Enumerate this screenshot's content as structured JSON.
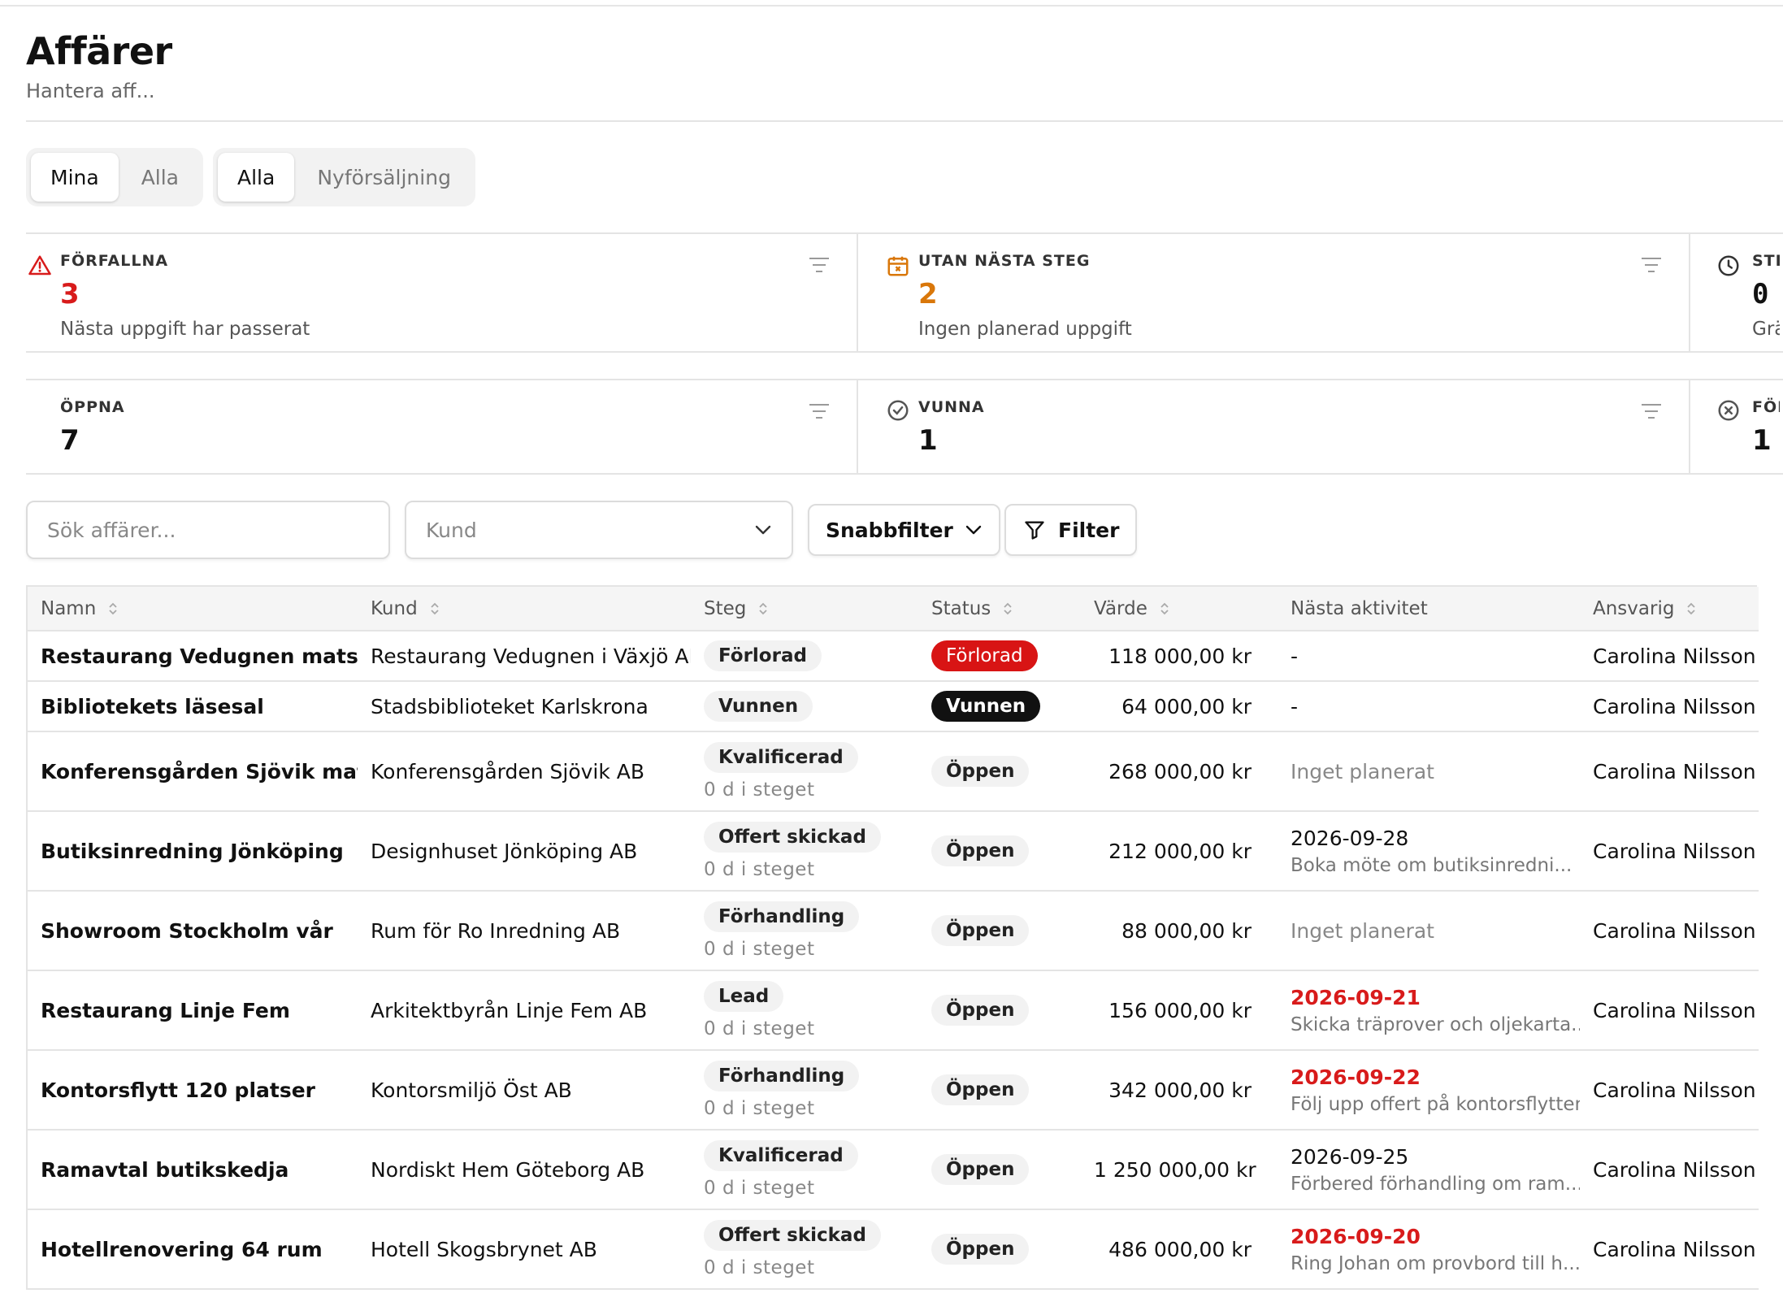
{
  "page": {
    "title": "Affärer",
    "subtitle": "Hantera aff..."
  },
  "scope_toggle": {
    "options": [
      "Mina",
      "Alla"
    ],
    "active": "Mina"
  },
  "type_toggle": {
    "options": [
      "Alla",
      "Nyförsäljning"
    ],
    "active": "Alla"
  },
  "kpis_top": [
    {
      "label": "FÖRFALLNA",
      "value": "3",
      "description": "Nästa uppgift har passerat",
      "icon": "warning-triangle-icon",
      "color": "#d81b1b"
    },
    {
      "label": "UTAN NÄSTA STEG",
      "value": "2",
      "description": "Ingen planerad uppgift",
      "icon": "calendar-x-icon",
      "color": "#d9770a"
    },
    {
      "label": "STILLA",
      "value": "0",
      "description": "Gränse",
      "icon": "clock-icon",
      "color": "#111111"
    }
  ],
  "kpis_bottom": [
    {
      "label": "ÖPPNA",
      "value": "7",
      "icon": ""
    },
    {
      "label": "VUNNA",
      "value": "1",
      "icon": "check-circle-icon"
    },
    {
      "label": "FÖRLOR",
      "value": "1",
      "icon": "x-circle-icon"
    }
  ],
  "toolbar": {
    "search_placeholder": "Sök affärer...",
    "customer_placeholder": "Kund",
    "quick_filter_label": "Snabbfilter",
    "filter_label": "Filter"
  },
  "table": {
    "columns": [
      "Namn",
      "Kund",
      "Steg",
      "Status",
      "Värde",
      "Nästa aktivitet",
      "Ansvarig"
    ],
    "rows": [
      {
        "name": "Restaurang Vedugnen matsal",
        "customer": "Restaurang Vedugnen i Växjö AB",
        "stage": "Förlorad",
        "days": "",
        "status": "Förlorad",
        "status_type": "lost",
        "value": "118 000,00 kr",
        "next_date": "-",
        "next_desc": "",
        "overdue": false,
        "owner": "Carolina Nilsson"
      },
      {
        "name": "Bibliotekets läsesal",
        "customer": "Stadsbiblioteket Karlskrona",
        "stage": "Vunnen",
        "days": "",
        "status": "Vunnen",
        "status_type": "won",
        "value": "64 000,00 kr",
        "next_date": "-",
        "next_desc": "",
        "overdue": false,
        "owner": "Carolina Nilsson"
      },
      {
        "name": "Konferensgården Sjövik matsal",
        "customer": "Konferensgården Sjövik AB",
        "stage": "Kvalificerad",
        "days": "0 d i steget",
        "status": "Öppen",
        "status_type": "open",
        "value": "268 000,00 kr",
        "next_date": "Inget planerat",
        "next_desc": "",
        "overdue": false,
        "muted": true,
        "owner": "Carolina Nilsson"
      },
      {
        "name": "Butiksinredning Jönköping",
        "customer": "Designhuset Jönköping AB",
        "stage": "Offert skickad",
        "days": "0 d i steget",
        "status": "Öppen",
        "status_type": "open",
        "value": "212 000,00 kr",
        "next_date": "2026-09-28",
        "next_desc": "Boka möte om butiksinredni...",
        "overdue": false,
        "owner": "Carolina Nilsson"
      },
      {
        "name": "Showroom Stockholm vår",
        "customer": "Rum för Ro Inredning AB",
        "stage": "Förhandling",
        "days": "0 d i steget",
        "status": "Öppen",
        "status_type": "open",
        "value": "88 000,00 kr",
        "next_date": "Inget planerat",
        "next_desc": "",
        "overdue": false,
        "muted": true,
        "owner": "Carolina Nilsson"
      },
      {
        "name": "Restaurang Linje Fem",
        "customer": "Arkitektbyrån Linje Fem AB",
        "stage": "Lead",
        "days": "0 d i steget",
        "status": "Öppen",
        "status_type": "open",
        "value": "156 000,00 kr",
        "next_date": "2026-09-21",
        "next_desc": "Skicka träprover och oljekarta...",
        "overdue": true,
        "owner": "Carolina Nilsson"
      },
      {
        "name": "Kontorsflytt 120 platser",
        "customer": "Kontorsmiljö Öst AB",
        "stage": "Förhandling",
        "days": "0 d i steget",
        "status": "Öppen",
        "status_type": "open",
        "value": "342 000,00 kr",
        "next_date": "2026-09-22",
        "next_desc": "Följ upp offert på kontorsflytten",
        "overdue": true,
        "owner": "Carolina Nilsson"
      },
      {
        "name": "Ramavtal butikskedja",
        "customer": "Nordiskt Hem Göteborg AB",
        "stage": "Kvalificerad",
        "days": "0 d i steget",
        "status": "Öppen",
        "status_type": "open",
        "value": "1 250 000,00 kr",
        "next_date": "2026-09-25",
        "next_desc": "Förbered förhandling om ram...",
        "overdue": false,
        "owner": "Carolina Nilsson"
      },
      {
        "name": "Hotellrenovering 64 rum",
        "customer": "Hotell Skogsbrynet AB",
        "stage": "Offert skickad",
        "days": "0 d i steget",
        "status": "Öppen",
        "status_type": "open",
        "value": "486 000,00 kr",
        "next_date": "2026-09-20",
        "next_desc": "Ring Johan om provbord till h...",
        "overdue": true,
        "owner": "Carolina Nilsson"
      }
    ]
  }
}
